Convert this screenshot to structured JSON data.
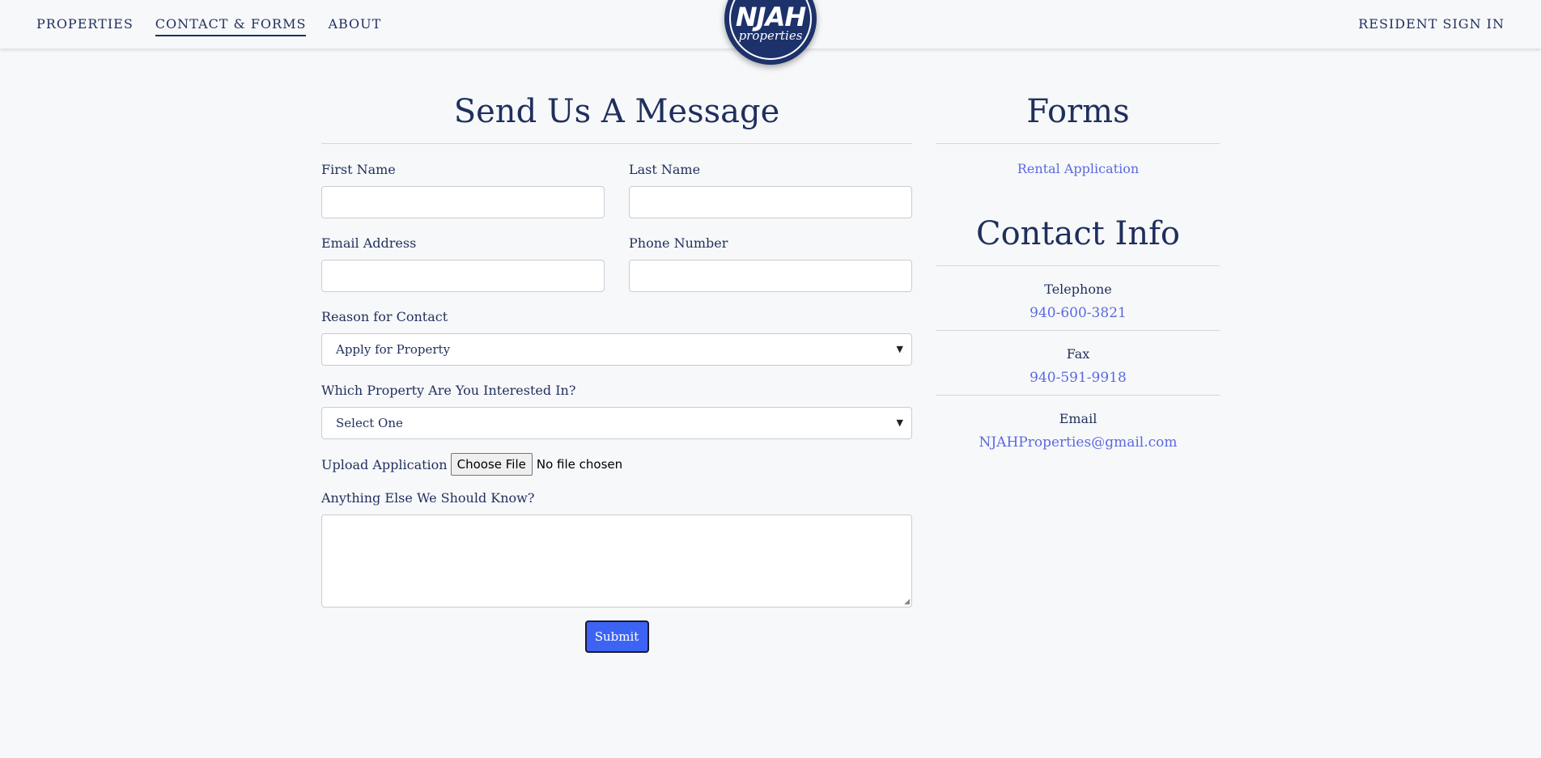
{
  "nav": {
    "left_links": [
      "PROPERTIES",
      "CONTACT & FORMS",
      "ABOUT"
    ],
    "active_link": "CONTACT & FORMS",
    "right_link": "RESIDENT SIGN IN"
  },
  "logo": {
    "main": "NJAH",
    "sub": "properties"
  },
  "form": {
    "title": "Send Us A Message",
    "first_name_label": "First Name",
    "last_name_label": "Last Name",
    "email_label": "Email Address",
    "phone_label": "Phone Number",
    "reason_label": "Reason for Contact",
    "reason_value": "Apply for Property",
    "property_label": "Which Property Are You Interested In?",
    "property_value": "Select One",
    "upload_label": "Upload Application",
    "choose_file_label": "Choose File",
    "no_file_text": "No file chosen",
    "notes_label": "Anything Else We Should Know?",
    "submit_label": "Submit"
  },
  "forms_section": {
    "title": "Forms",
    "links": [
      "Rental Application"
    ]
  },
  "contact_section": {
    "title": "Contact Info",
    "items": [
      {
        "label": "Telephone",
        "value": "940-600-3821"
      },
      {
        "label": "Fax",
        "value": "940-591-9918"
      },
      {
        "label": "Email",
        "value": "NJAHProperties@gmail.com"
      }
    ]
  },
  "icons": {
    "select_chevron": "chevron-down-icon",
    "textarea_resize": "resize-handle-icon"
  },
  "colors": {
    "navy": "#1f2f5c",
    "logo_bg": "#1d326b",
    "link": "#5a6ae0",
    "submit_bg": "#3d63f5",
    "page_bg": "#f7f8fa"
  }
}
